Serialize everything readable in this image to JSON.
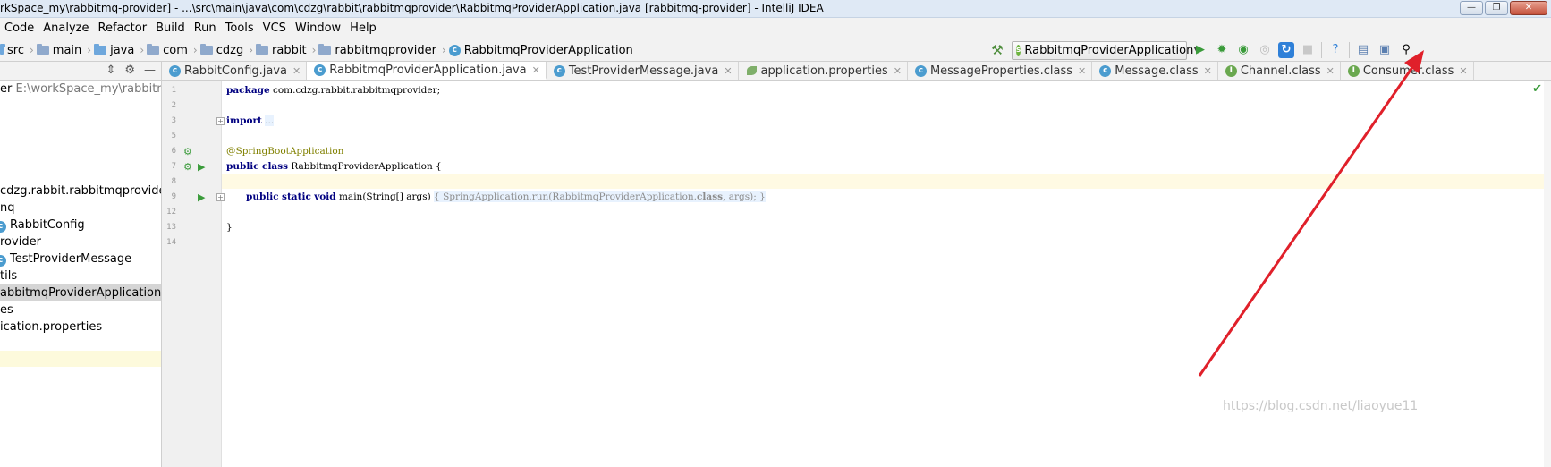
{
  "window": {
    "title": "rkSpace_my\\rabbitmq-provider] - ...\\src\\main\\java\\com\\cdzg\\rabbit\\rabbitmqprovider\\RabbitmqProviderApplication.java [rabbitmq-provider] - IntelliJ IDEA",
    "minimize": "—",
    "maximize": "❐",
    "close": "✕"
  },
  "menu": [
    "Code",
    "Analyze",
    "Refactor",
    "Build",
    "Run",
    "Tools",
    "VCS",
    "Window",
    "Help"
  ],
  "breadcrumbs": [
    {
      "label": "src",
      "icon": "folder-icon"
    },
    {
      "label": "main",
      "icon": "folder-icon"
    },
    {
      "label": "java",
      "icon": "folder-icon"
    },
    {
      "label": "com",
      "icon": "package-icon"
    },
    {
      "label": "cdzg",
      "icon": "package-icon"
    },
    {
      "label": "rabbit",
      "icon": "package-icon"
    },
    {
      "label": "rabbitmqprovider",
      "icon": "package-icon"
    },
    {
      "label": "RabbitmqProviderApplication",
      "icon": "class-icon"
    }
  ],
  "run_config": {
    "label": "RabbitmqProviderApplication"
  },
  "tabs": [
    {
      "label": "RabbitConfig.java",
      "icon": "class-icon",
      "active": false
    },
    {
      "label": "RabbitmqProviderApplication.java",
      "icon": "class-icon",
      "active": true
    },
    {
      "label": "TestProviderMessage.java",
      "icon": "class-icon",
      "active": false
    },
    {
      "label": "application.properties",
      "icon": "properties-icon",
      "active": false
    },
    {
      "label": "MessageProperties.class",
      "icon": "class-icon",
      "active": false
    },
    {
      "label": "Message.class",
      "icon": "class-icon",
      "active": false
    },
    {
      "label": "Channel.class",
      "icon": "interface-icon",
      "active": false
    },
    {
      "label": "Consumer.class",
      "icon": "interface-icon",
      "active": false
    }
  ],
  "project_tree": [
    {
      "label": "er",
      "extra": "E:\\workSpace_my\\rabbitmq-pro",
      "icon": "",
      "selected": false
    },
    {
      "label": "cdzg.rabbit.rabbitmqprovider",
      "icon": "",
      "selected": false
    },
    {
      "label": "nq",
      "icon": "",
      "selected": false
    },
    {
      "label": "RabbitConfig",
      "icon": "class-icon",
      "selected": false
    },
    {
      "label": "rovider",
      "icon": "",
      "selected": false
    },
    {
      "label": "TestProviderMessage",
      "icon": "class-icon",
      "selected": false
    },
    {
      "label": "tils",
      "icon": "",
      "selected": false
    },
    {
      "label": "abbitmqProviderApplication",
      "icon": "",
      "selected": true
    },
    {
      "label": "es",
      "icon": "",
      "selected": false
    },
    {
      "label": "ication.properties",
      "icon": "",
      "selected": false
    }
  ],
  "code": {
    "line_numbers": [
      "1",
      "2",
      "3",
      "5",
      "6",
      "7",
      "8",
      "9",
      "12",
      "13",
      "14"
    ],
    "package_kw": "package",
    "package_name": " com.cdzg.rabbit.rabbitmqprovider;",
    "import_kw": "import",
    "import_fold": "...",
    "annotation": "@SpringBootApplication",
    "class_kw1": "public",
    "class_kw2": "class",
    "class_name": " RabbitmqProviderApplication {",
    "main_kw1": "public",
    "main_kw2": "static",
    "main_kw3": "void",
    "main_sig": " main(String[] args) ",
    "main_body_open": "{ ",
    "main_body": "SpringApplication.run(RabbitmqProviderApplication.",
    "main_class_kw": "class",
    "main_body_end": ", args); ",
    "main_body_close": "}",
    "closing_brace": "}"
  },
  "watermark": "https://blog.csdn.net/liaoyue11"
}
